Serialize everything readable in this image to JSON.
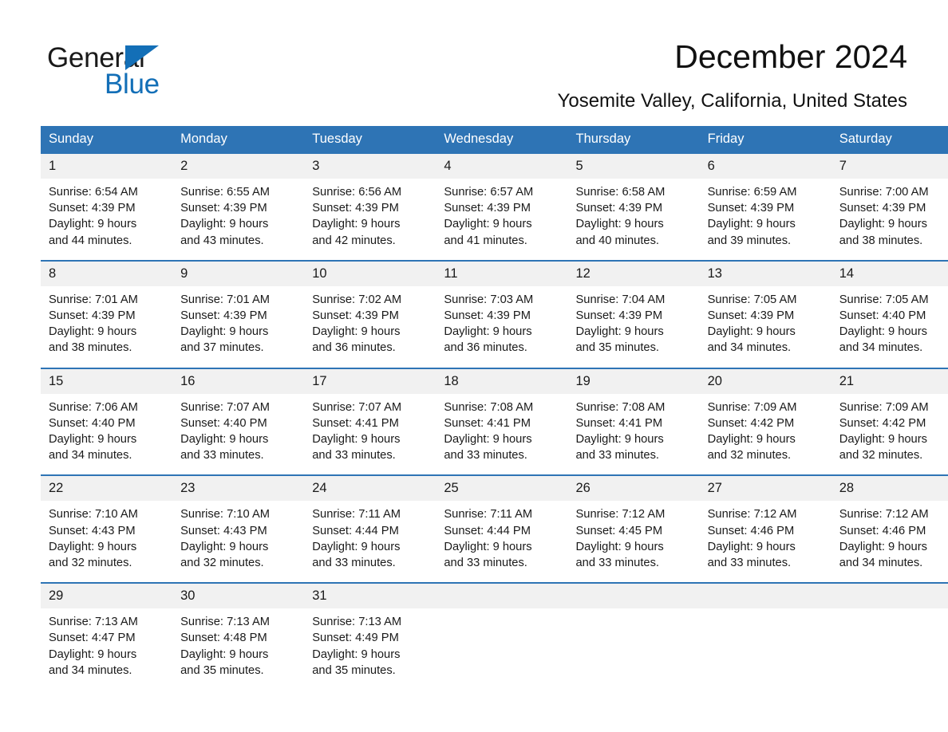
{
  "brand": {
    "name_part1": "General",
    "name_part2": "Blue",
    "triangle_color": "#136fb7",
    "accent_color": "#2e74b5"
  },
  "header": {
    "title": "December 2024",
    "subtitle": "Yosemite Valley, California, United States"
  },
  "calendar": {
    "weekday_headers": [
      "Sunday",
      "Monday",
      "Tuesday",
      "Wednesday",
      "Thursday",
      "Friday",
      "Saturday"
    ],
    "weeks": [
      [
        {
          "day": "1",
          "sunrise": "Sunrise: 6:54 AM",
          "sunset": "Sunset: 4:39 PM",
          "daylight_line1": "Daylight: 9 hours",
          "daylight_line2": "and 44 minutes."
        },
        {
          "day": "2",
          "sunrise": "Sunrise: 6:55 AM",
          "sunset": "Sunset: 4:39 PM",
          "daylight_line1": "Daylight: 9 hours",
          "daylight_line2": "and 43 minutes."
        },
        {
          "day": "3",
          "sunrise": "Sunrise: 6:56 AM",
          "sunset": "Sunset: 4:39 PM",
          "daylight_line1": "Daylight: 9 hours",
          "daylight_line2": "and 42 minutes."
        },
        {
          "day": "4",
          "sunrise": "Sunrise: 6:57 AM",
          "sunset": "Sunset: 4:39 PM",
          "daylight_line1": "Daylight: 9 hours",
          "daylight_line2": "and 41 minutes."
        },
        {
          "day": "5",
          "sunrise": "Sunrise: 6:58 AM",
          "sunset": "Sunset: 4:39 PM",
          "daylight_line1": "Daylight: 9 hours",
          "daylight_line2": "and 40 minutes."
        },
        {
          "day": "6",
          "sunrise": "Sunrise: 6:59 AM",
          "sunset": "Sunset: 4:39 PM",
          "daylight_line1": "Daylight: 9 hours",
          "daylight_line2": "and 39 minutes."
        },
        {
          "day": "7",
          "sunrise": "Sunrise: 7:00 AM",
          "sunset": "Sunset: 4:39 PM",
          "daylight_line1": "Daylight: 9 hours",
          "daylight_line2": "and 38 minutes."
        }
      ],
      [
        {
          "day": "8",
          "sunrise": "Sunrise: 7:01 AM",
          "sunset": "Sunset: 4:39 PM",
          "daylight_line1": "Daylight: 9 hours",
          "daylight_line2": "and 38 minutes."
        },
        {
          "day": "9",
          "sunrise": "Sunrise: 7:01 AM",
          "sunset": "Sunset: 4:39 PM",
          "daylight_line1": "Daylight: 9 hours",
          "daylight_line2": "and 37 minutes."
        },
        {
          "day": "10",
          "sunrise": "Sunrise: 7:02 AM",
          "sunset": "Sunset: 4:39 PM",
          "daylight_line1": "Daylight: 9 hours",
          "daylight_line2": "and 36 minutes."
        },
        {
          "day": "11",
          "sunrise": "Sunrise: 7:03 AM",
          "sunset": "Sunset: 4:39 PM",
          "daylight_line1": "Daylight: 9 hours",
          "daylight_line2": "and 36 minutes."
        },
        {
          "day": "12",
          "sunrise": "Sunrise: 7:04 AM",
          "sunset": "Sunset: 4:39 PM",
          "daylight_line1": "Daylight: 9 hours",
          "daylight_line2": "and 35 minutes."
        },
        {
          "day": "13",
          "sunrise": "Sunrise: 7:05 AM",
          "sunset": "Sunset: 4:39 PM",
          "daylight_line1": "Daylight: 9 hours",
          "daylight_line2": "and 34 minutes."
        },
        {
          "day": "14",
          "sunrise": "Sunrise: 7:05 AM",
          "sunset": "Sunset: 4:40 PM",
          "daylight_line1": "Daylight: 9 hours",
          "daylight_line2": "and 34 minutes."
        }
      ],
      [
        {
          "day": "15",
          "sunrise": "Sunrise: 7:06 AM",
          "sunset": "Sunset: 4:40 PM",
          "daylight_line1": "Daylight: 9 hours",
          "daylight_line2": "and 34 minutes."
        },
        {
          "day": "16",
          "sunrise": "Sunrise: 7:07 AM",
          "sunset": "Sunset: 4:40 PM",
          "daylight_line1": "Daylight: 9 hours",
          "daylight_line2": "and 33 minutes."
        },
        {
          "day": "17",
          "sunrise": "Sunrise: 7:07 AM",
          "sunset": "Sunset: 4:41 PM",
          "daylight_line1": "Daylight: 9 hours",
          "daylight_line2": "and 33 minutes."
        },
        {
          "day": "18",
          "sunrise": "Sunrise: 7:08 AM",
          "sunset": "Sunset: 4:41 PM",
          "daylight_line1": "Daylight: 9 hours",
          "daylight_line2": "and 33 minutes."
        },
        {
          "day": "19",
          "sunrise": "Sunrise: 7:08 AM",
          "sunset": "Sunset: 4:41 PM",
          "daylight_line1": "Daylight: 9 hours",
          "daylight_line2": "and 33 minutes."
        },
        {
          "day": "20",
          "sunrise": "Sunrise: 7:09 AM",
          "sunset": "Sunset: 4:42 PM",
          "daylight_line1": "Daylight: 9 hours",
          "daylight_line2": "and 32 minutes."
        },
        {
          "day": "21",
          "sunrise": "Sunrise: 7:09 AM",
          "sunset": "Sunset: 4:42 PM",
          "daylight_line1": "Daylight: 9 hours",
          "daylight_line2": "and 32 minutes."
        }
      ],
      [
        {
          "day": "22",
          "sunrise": "Sunrise: 7:10 AM",
          "sunset": "Sunset: 4:43 PM",
          "daylight_line1": "Daylight: 9 hours",
          "daylight_line2": "and 32 minutes."
        },
        {
          "day": "23",
          "sunrise": "Sunrise: 7:10 AM",
          "sunset": "Sunset: 4:43 PM",
          "daylight_line1": "Daylight: 9 hours",
          "daylight_line2": "and 32 minutes."
        },
        {
          "day": "24",
          "sunrise": "Sunrise: 7:11 AM",
          "sunset": "Sunset: 4:44 PM",
          "daylight_line1": "Daylight: 9 hours",
          "daylight_line2": "and 33 minutes."
        },
        {
          "day": "25",
          "sunrise": "Sunrise: 7:11 AM",
          "sunset": "Sunset: 4:44 PM",
          "daylight_line1": "Daylight: 9 hours",
          "daylight_line2": "and 33 minutes."
        },
        {
          "day": "26",
          "sunrise": "Sunrise: 7:12 AM",
          "sunset": "Sunset: 4:45 PM",
          "daylight_line1": "Daylight: 9 hours",
          "daylight_line2": "and 33 minutes."
        },
        {
          "day": "27",
          "sunrise": "Sunrise: 7:12 AM",
          "sunset": "Sunset: 4:46 PM",
          "daylight_line1": "Daylight: 9 hours",
          "daylight_line2": "and 33 minutes."
        },
        {
          "day": "28",
          "sunrise": "Sunrise: 7:12 AM",
          "sunset": "Sunset: 4:46 PM",
          "daylight_line1": "Daylight: 9 hours",
          "daylight_line2": "and 34 minutes."
        }
      ],
      [
        {
          "day": "29",
          "sunrise": "Sunrise: 7:13 AM",
          "sunset": "Sunset: 4:47 PM",
          "daylight_line1": "Daylight: 9 hours",
          "daylight_line2": "and 34 minutes."
        },
        {
          "day": "30",
          "sunrise": "Sunrise: 7:13 AM",
          "sunset": "Sunset: 4:48 PM",
          "daylight_line1": "Daylight: 9 hours",
          "daylight_line2": "and 35 minutes."
        },
        {
          "day": "31",
          "sunrise": "Sunrise: 7:13 AM",
          "sunset": "Sunset: 4:49 PM",
          "daylight_line1": "Daylight: 9 hours",
          "daylight_line2": "and 35 minutes."
        },
        {
          "day": "",
          "sunrise": "",
          "sunset": "",
          "daylight_line1": "",
          "daylight_line2": ""
        },
        {
          "day": "",
          "sunrise": "",
          "sunset": "",
          "daylight_line1": "",
          "daylight_line2": ""
        },
        {
          "day": "",
          "sunrise": "",
          "sunset": "",
          "daylight_line1": "",
          "daylight_line2": ""
        },
        {
          "day": "",
          "sunrise": "",
          "sunset": "",
          "daylight_line1": "",
          "daylight_line2": ""
        }
      ]
    ]
  }
}
